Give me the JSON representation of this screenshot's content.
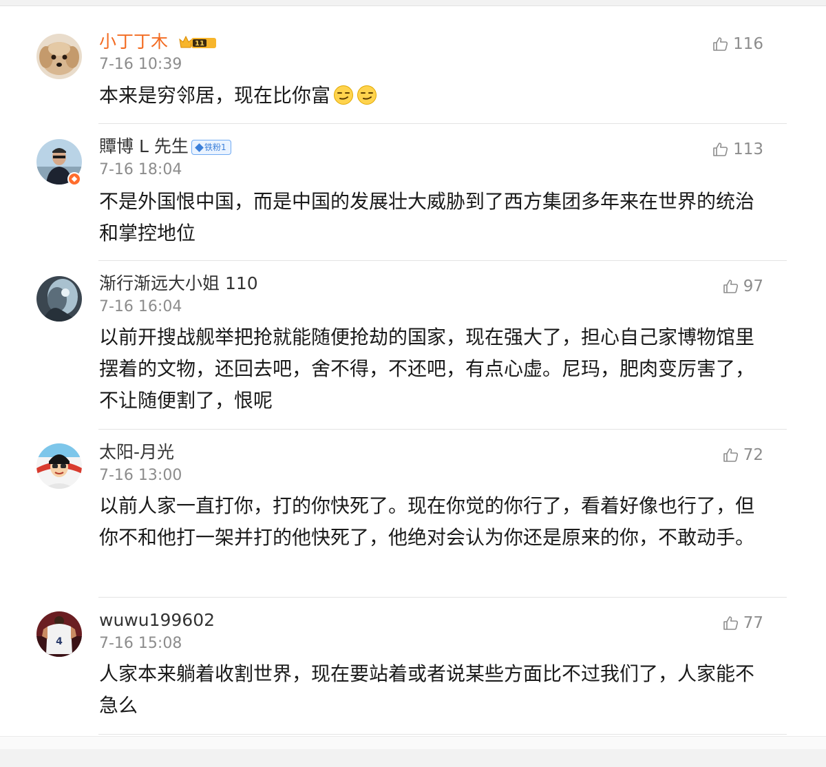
{
  "comments": [
    {
      "username": "小丁丁木",
      "level_badge": "11",
      "time": "7-16 10:39",
      "text": "本来是穷邻居，现在比你富",
      "emojis": [
        "smirk-emoji",
        "smirk-emoji"
      ],
      "likes": "116"
    },
    {
      "username": "贉博 L 先生",
      "fan_badge": "铁粉1",
      "time": "7-16 18:04",
      "text": "不是外国恨中国，而是中国的发展壮大威胁到了西方集团多年来在世界的统治和掌控地位",
      "likes": "113"
    },
    {
      "username": "渐行渐远大小姐 110",
      "time": "7-16 16:04",
      "text": "以前开搜战舰举把抢就能随便抢劫的国家，现在强大了，担心自己家博物馆里摆着的文物，还回去吧，舍不得，不还吧，有点心虚。尼玛，肥肉变厉害了，不让随便割了，恨呢",
      "likes": "97"
    },
    {
      "username": "太阳-月光",
      "time": "7-16 13:00",
      "text": "以前人家一直打你，打的你快死了。现在你觉的你行了，看着好像也行了，但你不和他打一架并打的他快死了，他绝对会认为你还是原来的你，不敢动手。",
      "likes": "72"
    },
    {
      "username": "wuwu199602",
      "time": "7-16 15:08",
      "text": "人家本来躺着收割世界，现在要站着或者说某些方面比不过我们了，人家能不急么",
      "likes": "77"
    }
  ],
  "colors": {
    "vip_name": "#f36b21",
    "name": "#333333",
    "meta": "#8c8c8c",
    "text": "#1a1a1a",
    "fan_badge": "#3b7fd9"
  },
  "icons": {
    "like": "thumbs-up-icon",
    "verified": "verified-badge-icon"
  }
}
